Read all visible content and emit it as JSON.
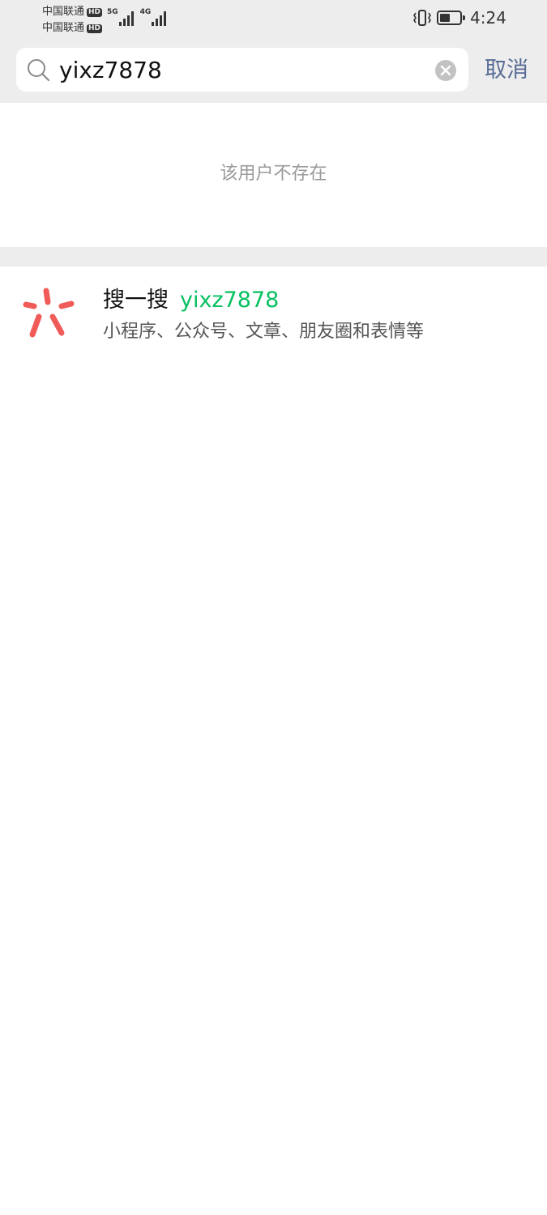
{
  "status_bar": {
    "carrier_1": "中国联通",
    "carrier_2": "中国联通",
    "hd_badge": "HD",
    "net_1": "5G",
    "net_2": "4G",
    "time": "4:24",
    "battery_level": 0.5
  },
  "search": {
    "value": "yixz7878",
    "cancel_label": "取消"
  },
  "result": {
    "not_found_text": "该用户不存在"
  },
  "sou_yi_sou": {
    "title": "搜一搜",
    "keyword": "yixz7878",
    "description": "小程序、公众号、文章、朋友圈和表情等"
  },
  "colors": {
    "accent_green": "#07c160",
    "link_blue": "#576b95",
    "logo_red": "#f05b58"
  }
}
